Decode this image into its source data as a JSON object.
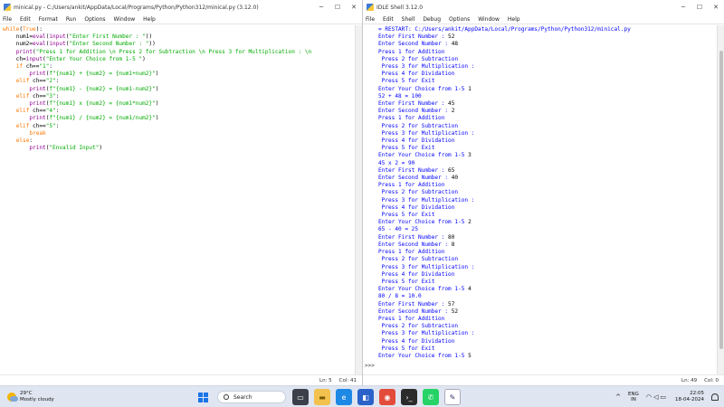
{
  "editor": {
    "title": "minical.py - C:/Users/ankit/AppData/Local/Programs/Python/Python312/minical.py (3.12.0)",
    "menu": [
      "File",
      "Edit",
      "Format",
      "Run",
      "Options",
      "Window",
      "Help"
    ],
    "status": {
      "line": "Ln: 5",
      "col": "Col: 41"
    }
  },
  "shell": {
    "title": "IDLE Shell 3.12.0",
    "menu": [
      "File",
      "Edit",
      "Shell",
      "Debug",
      "Options",
      "Window",
      "Help"
    ],
    "status": {
      "line": "Ln: 49",
      "col": "Col: 0"
    },
    "prompt": ">>>"
  },
  "taskbar": {
    "weather_temp": "29°C",
    "weather_desc": "Mostly cloudy",
    "search_label": "Search",
    "lang_top": "ENG",
    "lang_bottom": "IN",
    "time": "22:05",
    "date": "18-04-2024"
  },
  "colors": {
    "keyword": "#ff7700",
    "builtin": "#900090",
    "string": "#00aa00",
    "output": "#0000ff"
  },
  "icons": [
    "python-idle-icon",
    "minimize-icon",
    "maximize-icon",
    "close-icon",
    "weather-icon",
    "windows-start-icon",
    "search-icon",
    "task-view-icon",
    "file-explorer-icon",
    "edge-icon",
    "store-icon",
    "photos-icon",
    "terminal-icon",
    "whatsapp-icon",
    "idle-icon",
    "chevron-up-icon",
    "wifi-icon",
    "speaker-icon",
    "battery-icon",
    "bell-icon"
  ]
}
